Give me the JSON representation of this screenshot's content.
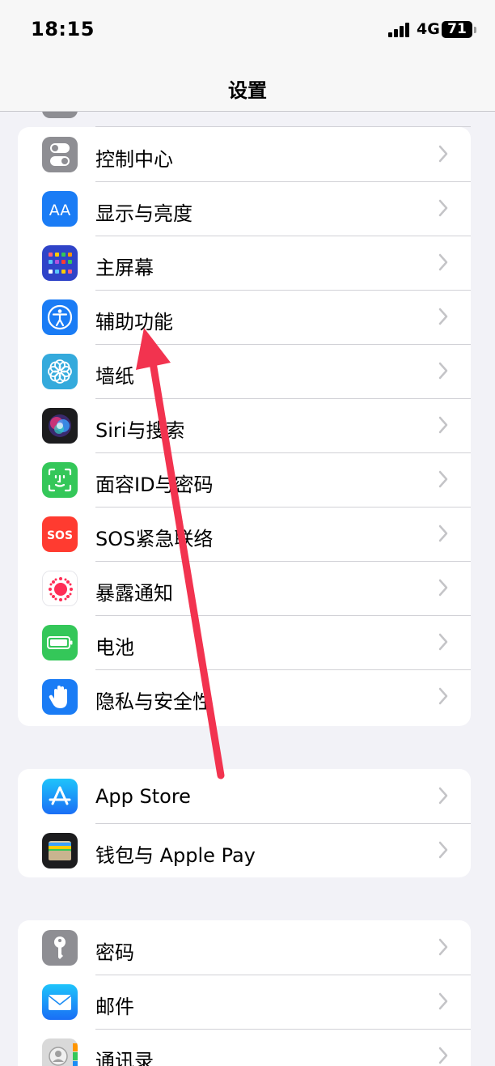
{
  "status_bar": {
    "time": "18:15",
    "network": "4G",
    "battery": "71"
  },
  "nav": {
    "title": "设置"
  },
  "groups": [
    {
      "items": [
        {
          "label": "控制中心",
          "icon": "control-center-icon",
          "color": "#8e8e93"
        },
        {
          "label": "显示与亮度",
          "icon": "display-brightness-icon",
          "color": "#1a7cf5"
        },
        {
          "label": "主屏幕",
          "icon": "home-screen-icon",
          "color": "#2f43c8"
        },
        {
          "label": "辅助功能",
          "icon": "accessibility-icon",
          "color": "#1a7cf5"
        },
        {
          "label": "墙纸",
          "icon": "wallpaper-icon",
          "color": "#34aadc"
        },
        {
          "label": "Siri与搜索",
          "icon": "siri-icon",
          "color": "#1c1c1e"
        },
        {
          "label": "面容ID与密码",
          "icon": "face-id-icon",
          "color": "#34c759"
        },
        {
          "label": "SOS紧急联络",
          "icon": "sos-icon",
          "color": "#ff3b30",
          "icon_text": "SOS"
        },
        {
          "label": "暴露通知",
          "icon": "exposure-notification-icon",
          "color": "#ffffff"
        },
        {
          "label": "电池",
          "icon": "battery-icon",
          "color": "#34c759"
        },
        {
          "label": "隐私与安全性",
          "icon": "privacy-hand-icon",
          "color": "#1a7cf5"
        }
      ]
    },
    {
      "items": [
        {
          "label": "App Store",
          "icon": "app-store-icon",
          "color": "#1a8cf5"
        },
        {
          "label": "钱包与 Apple Pay",
          "icon": "wallet-icon",
          "color": "#1c1c1e"
        }
      ]
    },
    {
      "items": [
        {
          "label": "密码",
          "icon": "key-icon",
          "color": "#8e8e93"
        },
        {
          "label": "邮件",
          "icon": "mail-icon",
          "color": "#1a8cf5"
        },
        {
          "label": "通讯录",
          "icon": "contacts-icon",
          "color": "#d9d9d9"
        }
      ]
    }
  ],
  "annotation": {
    "color": "#f2334f"
  }
}
